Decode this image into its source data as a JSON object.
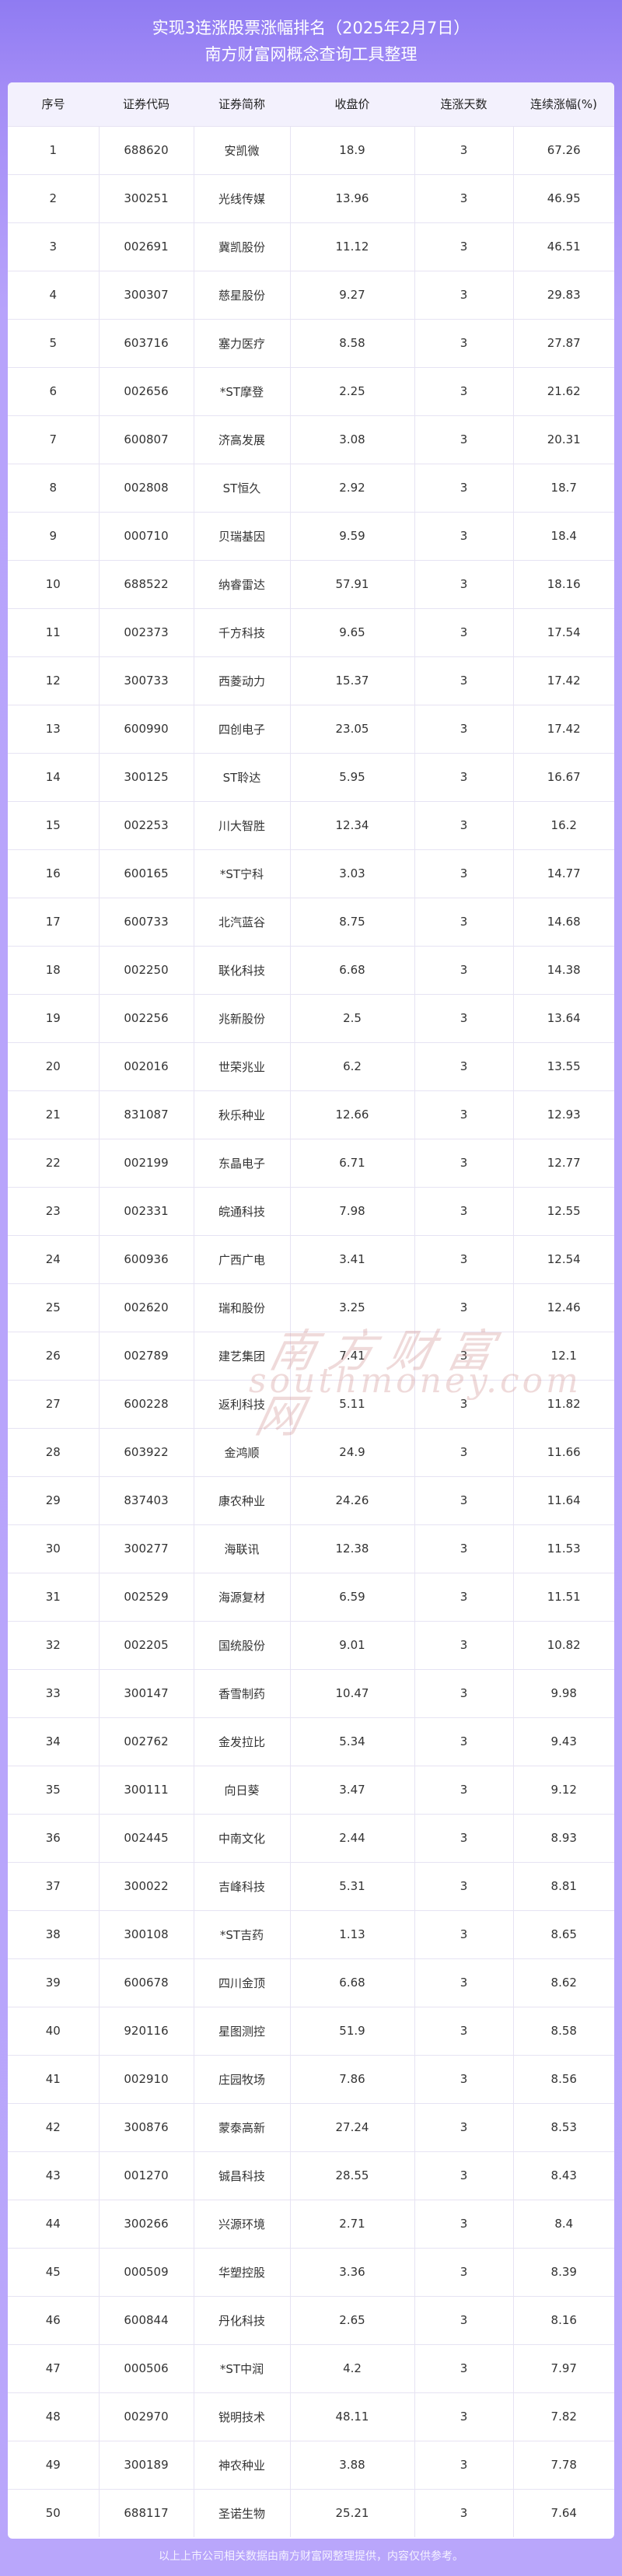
{
  "header": {
    "title": "实现3连涨股票涨幅排名（2025年2月7日）",
    "subtitle": "南方财富网概念查询工具整理"
  },
  "table": {
    "columns": [
      "序号",
      "证券代码",
      "证券简称",
      "收盘价",
      "连涨天数",
      "连续涨幅(%)"
    ],
    "rows": [
      [
        "1",
        "688620",
        "安凯微",
        "18.9",
        "3",
        "67.26"
      ],
      [
        "2",
        "300251",
        "光线传媒",
        "13.96",
        "3",
        "46.95"
      ],
      [
        "3",
        "002691",
        "冀凯股份",
        "11.12",
        "3",
        "46.51"
      ],
      [
        "4",
        "300307",
        "慈星股份",
        "9.27",
        "3",
        "29.83"
      ],
      [
        "5",
        "603716",
        "塞力医疗",
        "8.58",
        "3",
        "27.87"
      ],
      [
        "6",
        "002656",
        "*ST摩登",
        "2.25",
        "3",
        "21.62"
      ],
      [
        "7",
        "600807",
        "济高发展",
        "3.08",
        "3",
        "20.31"
      ],
      [
        "8",
        "002808",
        "ST恒久",
        "2.92",
        "3",
        "18.7"
      ],
      [
        "9",
        "000710",
        "贝瑞基因",
        "9.59",
        "3",
        "18.4"
      ],
      [
        "10",
        "688522",
        "纳睿雷达",
        "57.91",
        "3",
        "18.16"
      ],
      [
        "11",
        "002373",
        "千方科技",
        "9.65",
        "3",
        "17.54"
      ],
      [
        "12",
        "300733",
        "西菱动力",
        "15.37",
        "3",
        "17.42"
      ],
      [
        "13",
        "600990",
        "四创电子",
        "23.05",
        "3",
        "17.42"
      ],
      [
        "14",
        "300125",
        "ST聆达",
        "5.95",
        "3",
        "16.67"
      ],
      [
        "15",
        "002253",
        "川大智胜",
        "12.34",
        "3",
        "16.2"
      ],
      [
        "16",
        "600165",
        "*ST宁科",
        "3.03",
        "3",
        "14.77"
      ],
      [
        "17",
        "600733",
        "北汽蓝谷",
        "8.75",
        "3",
        "14.68"
      ],
      [
        "18",
        "002250",
        "联化科技",
        "6.68",
        "3",
        "14.38"
      ],
      [
        "19",
        "002256",
        "兆新股份",
        "2.5",
        "3",
        "13.64"
      ],
      [
        "20",
        "002016",
        "世荣兆业",
        "6.2",
        "3",
        "13.55"
      ],
      [
        "21",
        "831087",
        "秋乐种业",
        "12.66",
        "3",
        "12.93"
      ],
      [
        "22",
        "002199",
        "东晶电子",
        "6.71",
        "3",
        "12.77"
      ],
      [
        "23",
        "002331",
        "皖通科技",
        "7.98",
        "3",
        "12.55"
      ],
      [
        "24",
        "600936",
        "广西广电",
        "3.41",
        "3",
        "12.54"
      ],
      [
        "25",
        "002620",
        "瑞和股份",
        "3.25",
        "3",
        "12.46"
      ],
      [
        "26",
        "002789",
        "建艺集团",
        "7.41",
        "3",
        "12.1"
      ],
      [
        "27",
        "600228",
        "返利科技",
        "5.11",
        "3",
        "11.82"
      ],
      [
        "28",
        "603922",
        "金鸿顺",
        "24.9",
        "3",
        "11.66"
      ],
      [
        "29",
        "837403",
        "康农种业",
        "24.26",
        "3",
        "11.64"
      ],
      [
        "30",
        "300277",
        "海联讯",
        "12.38",
        "3",
        "11.53"
      ],
      [
        "31",
        "002529",
        "海源复材",
        "6.59",
        "3",
        "11.51"
      ],
      [
        "32",
        "002205",
        "国统股份",
        "9.01",
        "3",
        "10.82"
      ],
      [
        "33",
        "300147",
        "香雪制药",
        "10.47",
        "3",
        "9.98"
      ],
      [
        "34",
        "002762",
        "金发拉比",
        "5.34",
        "3",
        "9.43"
      ],
      [
        "35",
        "300111",
        "向日葵",
        "3.47",
        "3",
        "9.12"
      ],
      [
        "36",
        "002445",
        "中南文化",
        "2.44",
        "3",
        "8.93"
      ],
      [
        "37",
        "300022",
        "吉峰科技",
        "5.31",
        "3",
        "8.81"
      ],
      [
        "38",
        "300108",
        "*ST吉药",
        "1.13",
        "3",
        "8.65"
      ],
      [
        "39",
        "600678",
        "四川金顶",
        "6.68",
        "3",
        "8.62"
      ],
      [
        "40",
        "920116",
        "星图测控",
        "51.9",
        "3",
        "8.58"
      ],
      [
        "41",
        "002910",
        "庄园牧场",
        "7.86",
        "3",
        "8.56"
      ],
      [
        "42",
        "300876",
        "蒙泰高新",
        "27.24",
        "3",
        "8.53"
      ],
      [
        "43",
        "001270",
        "铖昌科技",
        "28.55",
        "3",
        "8.43"
      ],
      [
        "44",
        "300266",
        "兴源环境",
        "2.71",
        "3",
        "8.4"
      ],
      [
        "45",
        "000509",
        "华塑控股",
        "3.36",
        "3",
        "8.39"
      ],
      [
        "46",
        "600844",
        "丹化科技",
        "2.65",
        "3",
        "8.16"
      ],
      [
        "47",
        "000506",
        "*ST中润",
        "4.2",
        "3",
        "7.97"
      ],
      [
        "48",
        "002970",
        "锐明技术",
        "48.11",
        "3",
        "7.82"
      ],
      [
        "49",
        "300189",
        "神农种业",
        "3.88",
        "3",
        "7.78"
      ],
      [
        "50",
        "688117",
        "圣诺生物",
        "25.21",
        "3",
        "7.64"
      ]
    ]
  },
  "watermark": {
    "cn": "南方财富网",
    "en": "southmoney.com"
  },
  "footer": {
    "text": "以上上市公司相关数据由南方财富网整理提供，内容仅供参考。"
  },
  "colors": {
    "background_top": "#8f7bf2",
    "background_bottom": "#b9a6fb",
    "table_header_bg": "#f3f1fd",
    "grid_line": "#e6e3f3"
  }
}
